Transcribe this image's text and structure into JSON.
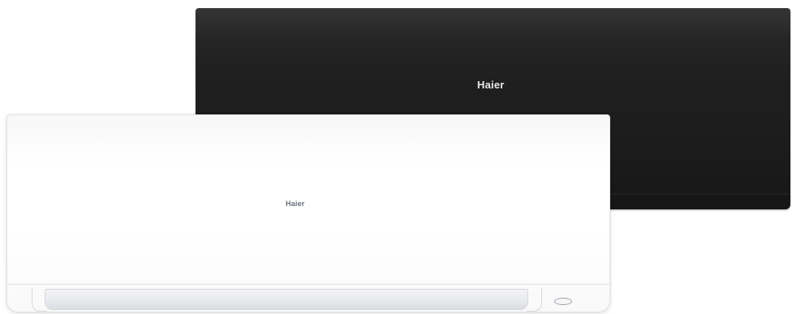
{
  "units": {
    "black": {
      "brand": "Haier",
      "color": "#1c1c1c"
    },
    "white": {
      "brand": "Haier",
      "color": "#ffffff"
    }
  }
}
